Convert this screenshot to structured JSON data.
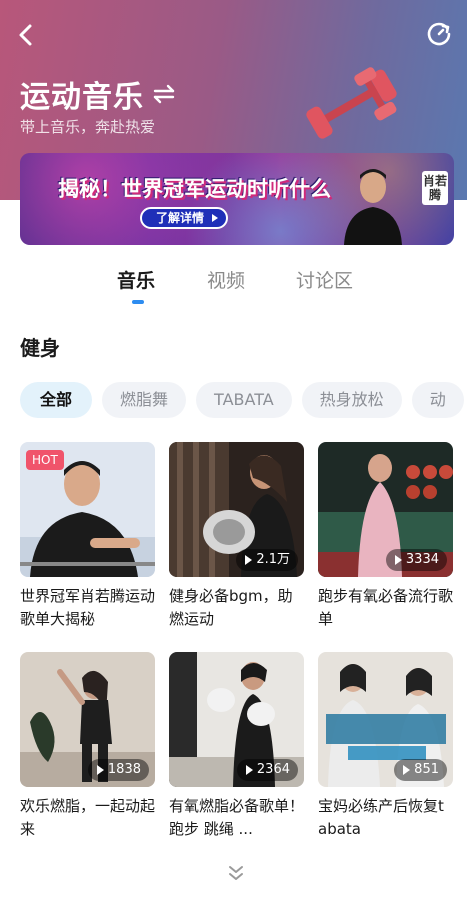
{
  "header": {
    "title": "运动音乐",
    "subtitle": "带上音乐，奔赴热爱"
  },
  "banner": {
    "headline": "揭秘！世界冠军运动时听什么",
    "cta": "了解详情",
    "name_tag": "肖若腾"
  },
  "tabs": [
    {
      "label": "音乐",
      "active": true
    },
    {
      "label": "视频",
      "active": false
    },
    {
      "label": "讨论区",
      "active": false
    }
  ],
  "section": {
    "title": "健身"
  },
  "chips": [
    {
      "label": "全部",
      "active": true
    },
    {
      "label": "燃脂舞",
      "active": false
    },
    {
      "label": "TABATA",
      "active": false
    },
    {
      "label": "热身放松",
      "active": false
    },
    {
      "label": "动",
      "active": false
    }
  ],
  "cards": [
    {
      "title": "世界冠军肖若腾运动歌单大揭秘",
      "badge": "HOT",
      "count": ""
    },
    {
      "title": "健身必备bgm，助燃运动",
      "badge": "",
      "count": "2.1万"
    },
    {
      "title": "跑步有氧必备流行歌单",
      "badge": "",
      "count": "3334"
    },
    {
      "title": "欢乐燃脂，一起动起来",
      "badge": "",
      "count": "1838"
    },
    {
      "title": "有氧燃脂必备歌单！跑步 跳绳 ...",
      "badge": "",
      "count": "2364"
    },
    {
      "title": "宝妈必练产后恢复tabata",
      "badge": "",
      "count": "851"
    }
  ],
  "icons": {
    "back": "back-arrow-icon",
    "refresh": "refresh-icon",
    "swap": "swap-icon",
    "more": "chevron-double-down-icon"
  },
  "colors": {
    "accent": "#2d8cf0",
    "hot": "#f0546b",
    "chip_active_bg": "#e3f2fb"
  }
}
